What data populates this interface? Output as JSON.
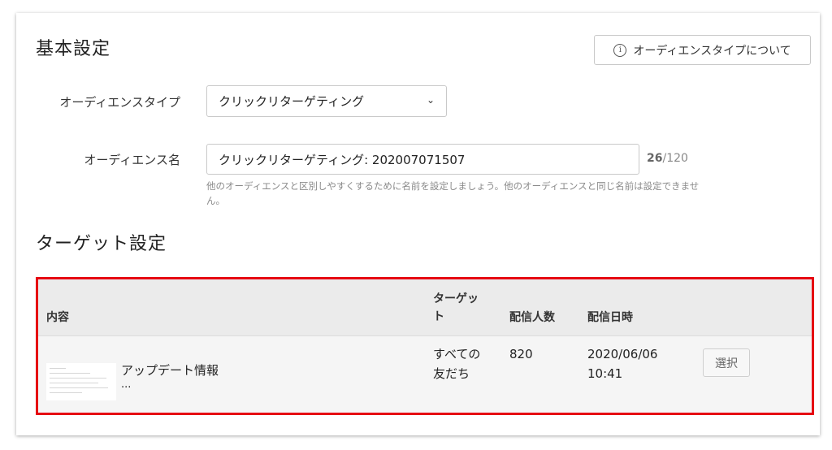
{
  "basic": {
    "title": "基本設定",
    "about_button": "オーディエンスタイプについて",
    "audience_type_label": "オーディエンスタイプ",
    "audience_type_value": "クリックリターゲティング",
    "audience_name_label": "オーディエンス名",
    "audience_name_value": "クリックリターゲティング: 202007071507",
    "counter_current": "26",
    "counter_max": "/120",
    "help_text": "他のオーディエンスと区別しやすくするために名前を設定しましょう。他のオーディエンスと同じ名前は設定できません。"
  },
  "target": {
    "title": "ターゲット設定",
    "columns": {
      "content": "内容",
      "target": "ターゲット",
      "count": "配信人数",
      "datetime": "配信日時"
    },
    "rows": [
      {
        "title": "アップデート情報",
        "ellipsis": "...",
        "target": "すべての友だち",
        "count": "820",
        "date": "2020/06/06",
        "time": "10:41",
        "action": "選択"
      }
    ]
  },
  "colors": {
    "highlight_border": "#e60012",
    "header_bg": "#ebebeb"
  }
}
